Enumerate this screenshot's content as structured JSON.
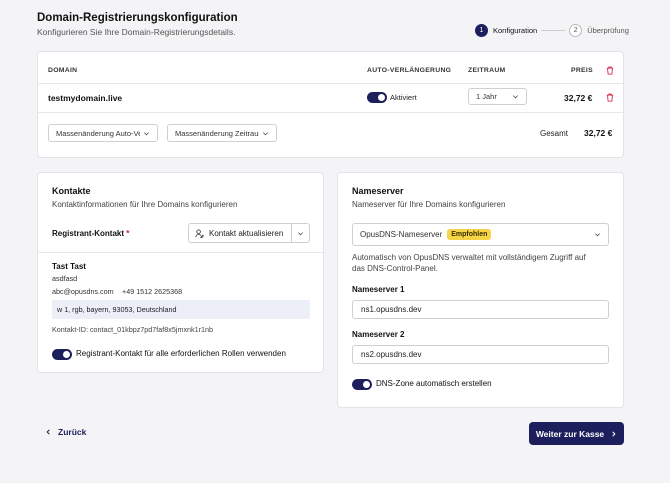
{
  "header": {
    "title": "Domain-Registrierungskonfiguration",
    "subtitle": "Konfigurieren Sie Ihre Domain-Registrierungsdetails."
  },
  "stepper": {
    "steps": [
      {
        "number": "1",
        "label": "Konfiguration"
      },
      {
        "number": "2",
        "label": "Überprüfung"
      }
    ]
  },
  "domains_table": {
    "headers": {
      "domain": "DOMAIN",
      "auto_renew": "AUTO-VERLÄNGERUNG",
      "period": "ZEITRAUM",
      "price": "PREIS"
    },
    "rows": [
      {
        "domain": "testmydomain.live",
        "auto_renew_label": "Aktiviert",
        "period": "1 Jahr",
        "price": "32,72 €"
      }
    ],
    "bulk_auto_renew": "Massenänderung Auto-Ve",
    "bulk_period": "Massenänderung Zeitraum",
    "total_label": "Gesamt",
    "total_value": "32,72 €"
  },
  "contacts": {
    "title": "Kontakte",
    "description": "Kontaktinformationen für Ihre Domains konfigurieren",
    "registrant_label": "Registrant-Kontakt",
    "required_mark": "*",
    "update_button": "Kontakt aktualisieren",
    "name": "Tast Tast",
    "org": "asdfasd",
    "email": "abc@opusdns.com",
    "phone": "+49 1512 2625368",
    "address": "w 1, rgb, bayern, 93053, Deutschland",
    "contact_id": "Kontakt-ID: contact_01kbpz7pd7faf8x5jmxnk1r1nb",
    "use_for_all_label": "Registrant-Kontakt für alle erforderlichen Rollen verwenden"
  },
  "nameserver": {
    "title": "Nameserver",
    "description": "Nameserver für Ihre Domains konfigurieren",
    "selected_option": "OpusDNS-Nameserver",
    "badge": "Empfohlen",
    "info_line1": "Automatisch von OpusDNS verwaltet mit vollständigem Zugriff auf",
    "info_line2": "das DNS-Control-Panel.",
    "ns1_label": "Nameserver 1",
    "ns1_value": "ns1.opusdns.dev",
    "ns2_label": "Nameserver 2",
    "ns2_value": "ns2.opusdns.dev",
    "dns_zone_label": "DNS-Zone automatisch erstellen"
  },
  "footer": {
    "back": "Zurück",
    "next": "Weiter zur Kasse"
  },
  "colors": {
    "primary": "#1c1f5c",
    "badge": "#f5d445",
    "danger": "#d0103a"
  }
}
